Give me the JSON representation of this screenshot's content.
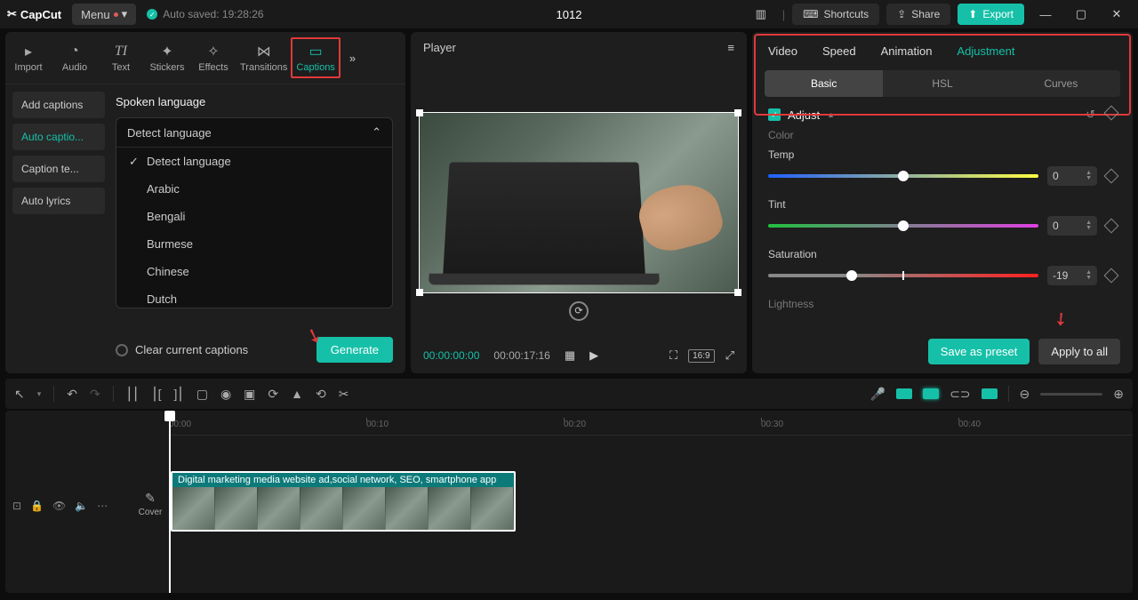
{
  "app": {
    "name": "CapCut",
    "menu": "Menu",
    "autosave": "Auto saved: 19:28:26",
    "title": "1012"
  },
  "titlebar": {
    "shortcuts": "Shortcuts",
    "share": "Share",
    "export": "Export"
  },
  "tools": {
    "import": "Import",
    "audio": "Audio",
    "text": "Text",
    "stickers": "Stickers",
    "effects": "Effects",
    "transitions": "Transitions",
    "captions": "Captions"
  },
  "side": {
    "add": "Add captions",
    "auto": "Auto captio...",
    "template": "Caption te...",
    "lyrics": "Auto lyrics"
  },
  "lang": {
    "title": "Spoken language",
    "selected": "Detect language",
    "options": [
      "Detect language",
      "Arabic",
      "Bengali",
      "Burmese",
      "Chinese",
      "Dutch"
    ]
  },
  "captions": {
    "clear": "Clear current captions",
    "generate": "Generate"
  },
  "player": {
    "label": "Player",
    "t1": "00:00:00:00",
    "t2": "00:00:17:16",
    "aspect": "16:9"
  },
  "right": {
    "tabs": {
      "video": "Video",
      "speed": "Speed",
      "animation": "Animation",
      "adjustment": "Adjustment"
    },
    "subtabs": {
      "basic": "Basic",
      "hsl": "HSL",
      "curves": "Curves"
    },
    "adjust": "Adjust",
    "color": "Color",
    "lightness": "Lightness",
    "temp": {
      "label": "Temp",
      "value": "0"
    },
    "tint": {
      "label": "Tint",
      "value": "0"
    },
    "sat": {
      "label": "Saturation",
      "value": "-19"
    },
    "preset": "Save as preset",
    "apply": "Apply to all"
  },
  "timeline": {
    "ticks": [
      "00:00",
      "00:10",
      "00:20",
      "00:30",
      "00:40"
    ],
    "cover": "Cover",
    "clip_label": "Digital marketing media website ad,social network, SEO, smartphone app"
  }
}
